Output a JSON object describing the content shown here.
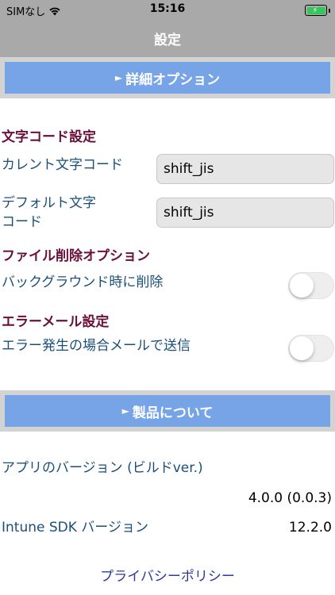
{
  "status_bar": {
    "carrier": "SIMなし",
    "time": "15:16"
  },
  "nav": {
    "title": "設定"
  },
  "detail_options": {
    "label": "詳細オプション"
  },
  "charset_settings": {
    "heading": "文字コード設定",
    "current_label": "カレント文字コード",
    "current_value": "shift_jis",
    "default_label_line1": "デフォルト文字",
    "default_label_line2": "コード",
    "default_value": "shift_jis"
  },
  "file_delete": {
    "heading": "ファイル削除オプション",
    "background_delete_label": "バックグラウンド時に削除",
    "background_delete_on": false
  },
  "error_mail": {
    "heading": "エラーメール設定",
    "send_on_error_label": "エラー発生の場合メールで送信",
    "send_on_error_on": false
  },
  "about": {
    "label": "製品について",
    "app_version_label": "アプリのバージョン (ビルドver.)",
    "app_version_value": "4.0.0 (0.0.3)",
    "sdk_version_label": "Intune SDK バージョン",
    "sdk_version_value": "12.2.0",
    "privacy_policy": "プライバシーポリシー"
  },
  "colors": {
    "header_bg": "#a9a9a9",
    "button_bg": "#76a4e6",
    "heading_text": "#6b0f3a",
    "label_text": "#1a4f7a",
    "battery": "#34c759"
  }
}
